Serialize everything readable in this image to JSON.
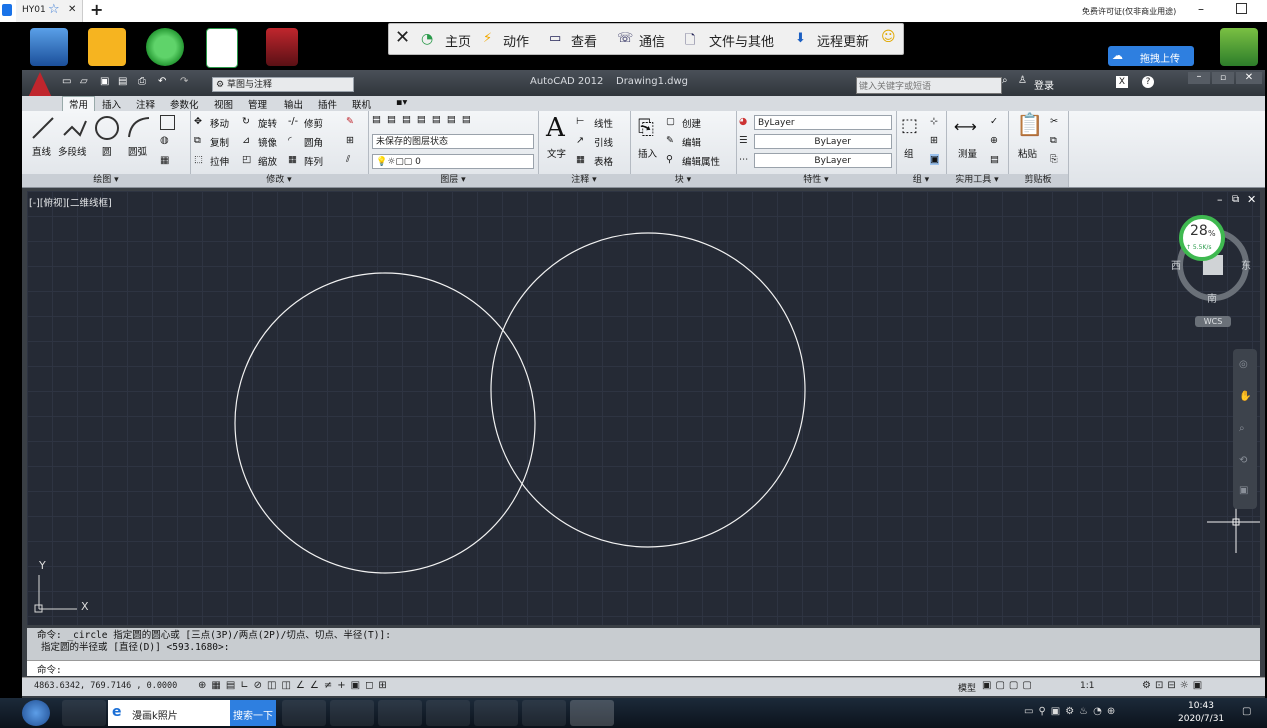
{
  "remote_tab": {
    "title": "HY01",
    "close": "✕",
    "new": "+",
    "license_notice": "免费许可证(仅非商业用途)"
  },
  "remote_toolbar": {
    "items": [
      {
        "label": "主页"
      },
      {
        "label": "动作"
      },
      {
        "label": "查看"
      },
      {
        "label": "通信"
      },
      {
        "label": "文件与其他"
      },
      {
        "label": "远程更新"
      }
    ]
  },
  "desktop": {
    "upload_button": "拖拽上传"
  },
  "acad": {
    "app_title": "AutoCAD 2012",
    "file_name": "Drawing1.dwg",
    "workspace": "草图与注释",
    "search_placeholder": "键入关键字或短语",
    "login": "登录",
    "ribbon_tabs": [
      "常用",
      "插入",
      "注释",
      "参数化",
      "视图",
      "管理",
      "输出",
      "插件",
      "联机"
    ],
    "draw": {
      "line": "直线",
      "polyline": "多段线",
      "circle": "圆",
      "arc": "圆弧",
      "panel": "绘图"
    },
    "modify": {
      "move": "移动",
      "rotate": "旋转",
      "trim": "修剪",
      "copy": "复制",
      "mirror": "镜像",
      "fillet": "圆角",
      "stretch": "拉伸",
      "scale": "缩放",
      "array": "阵列",
      "panel": "修改"
    },
    "layers": {
      "state": "未保存的图层状态",
      "current": "0",
      "panel": "图层"
    },
    "annotation": {
      "text": "文字",
      "linear": "线性",
      "leader": "引线",
      "table": "表格",
      "panel": "注释"
    },
    "block": {
      "insert": "插入",
      "create": "创建",
      "edit": "编辑",
      "edit_attr": "编辑属性",
      "panel": "块"
    },
    "properties": {
      "color": "ByLayer",
      "linetype": "ByLayer",
      "lineweight": "ByLayer",
      "panel": "特性"
    },
    "group": {
      "label": "组",
      "panel": "组"
    },
    "utilities": {
      "measure": "测量",
      "panel": "实用工具"
    },
    "clipboard": {
      "paste": "粘贴",
      "panel": "剪贴板"
    },
    "viewport_label": "[-][俯视][二维线框]",
    "viewcube": {
      "west": "西",
      "east": "东",
      "south": "南",
      "wcs": "WCS"
    },
    "perf_widget": {
      "percent": "28",
      "unit": "%",
      "speed": "↑ 5.5K/s"
    },
    "ucs": {
      "x": "X",
      "y": "Y"
    },
    "command_history": [
      "命令: _circle 指定圆的圆心或 [三点(3P)/两点(2P)/切点、切点、半径(T)]:",
      "指定圆的半径或 [直径(D)] <593.1680>:"
    ],
    "command_prompt": "命令:",
    "coordinates": "4863.6342, 769.7146 , 0.0000",
    "status_model": "模型",
    "status_scale": "1:1"
  },
  "taskbar": {
    "ie_label": "漫画k照片",
    "search_btn": "搜索一下",
    "time": "10:43",
    "date": "2020/7/31"
  },
  "colors": {
    "viewport_bg": "#252a35",
    "ribbon_bg": "#e8ebee",
    "accent_red": "#c0262d"
  }
}
